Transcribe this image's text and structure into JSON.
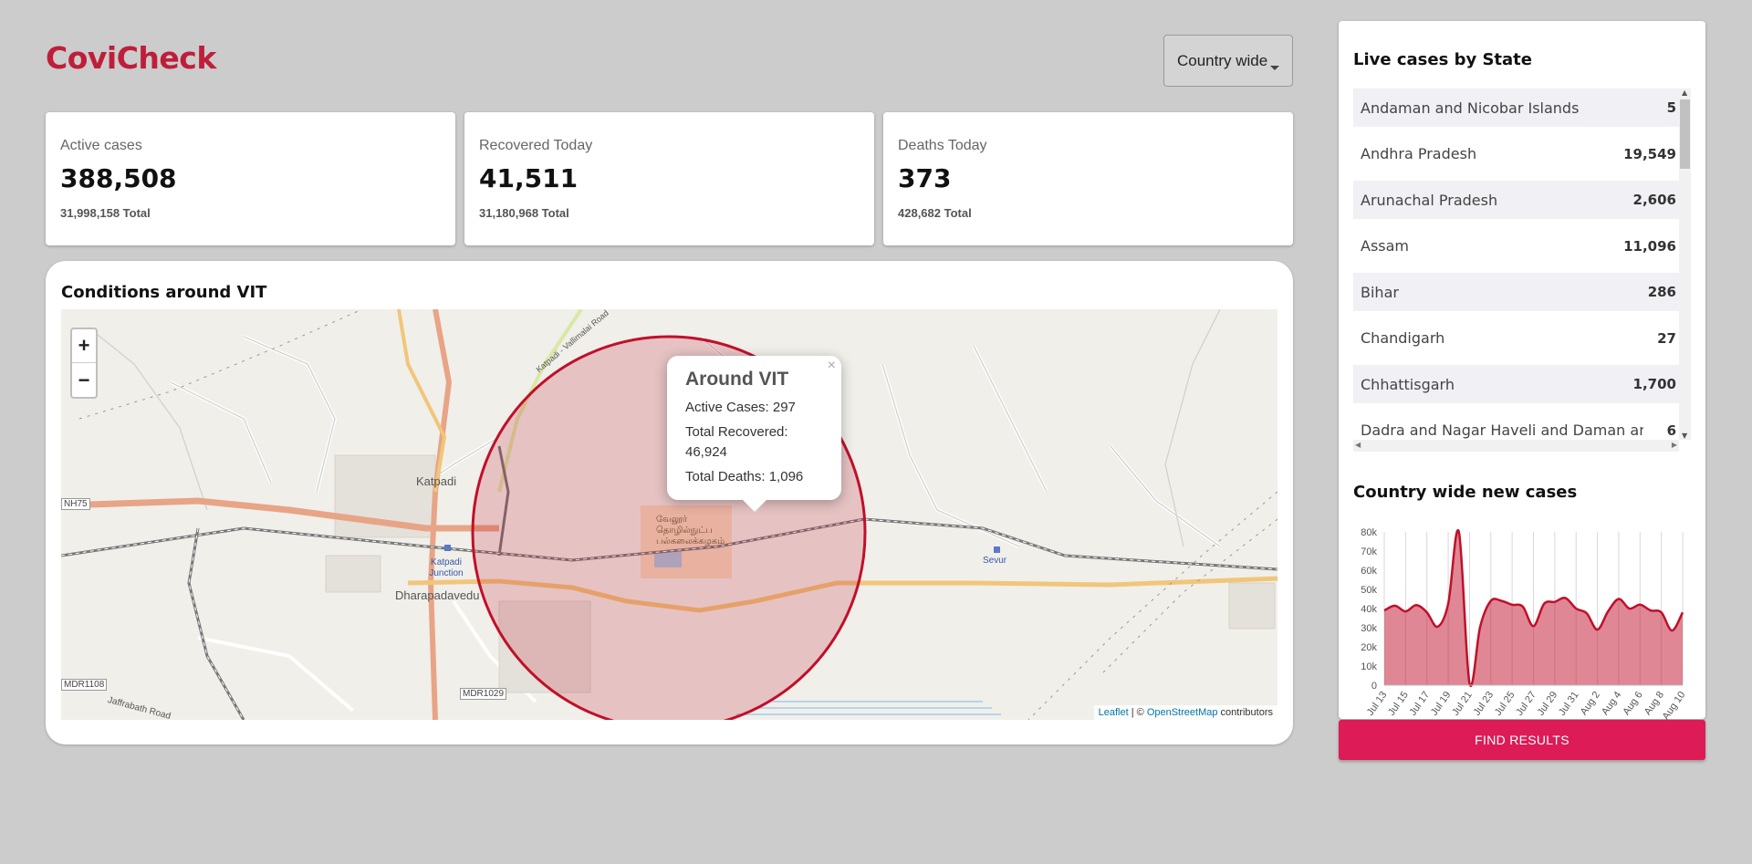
{
  "app": {
    "title": "CoviCheck"
  },
  "region_select": {
    "value": "Country wide"
  },
  "stats": [
    {
      "label": "Active cases",
      "value": "388,508",
      "total": "31,998,158 Total"
    },
    {
      "label": "Recovered Today",
      "value": "41,511",
      "total": "31,180,968 Total"
    },
    {
      "label": "Deaths Today",
      "value": "373",
      "total": "428,682 Total"
    }
  ],
  "map": {
    "title": "Conditions around VIT",
    "zoom_in": "+",
    "zoom_out": "−",
    "popup": {
      "title": "Around VIT",
      "active": "Active Cases: 297",
      "recovered": "Total Recovered: 46,924",
      "deaths": "Total Deaths: 1,096",
      "close": "×"
    },
    "labels": {
      "katpadi": "Katpadi",
      "dharapadavedu": "Dharapadavedu",
      "katpadi_junction": "Katpadi Junction",
      "sevur": "Sevur",
      "nh75": "NH75",
      "mdr1108": "MDR1108",
      "mdr1029": "MDR1029",
      "jaffrabath": "Jaffrabath Road",
      "vallimalai": "Katpadi - Vallimalai Road",
      "campus": "வேலூர் தொழில்நுட்ப பல்கலைக்கழகம்"
    },
    "attribution": {
      "leaflet": "Leaflet",
      "sep": " | © ",
      "osm": "OpenStreetMap",
      "suffix": " contributors"
    },
    "circle_color": "#c0102a"
  },
  "states": {
    "title": "Live cases by State",
    "rows": [
      {
        "name": "Andaman and Nicobar Islands",
        "value": "5"
      },
      {
        "name": "Andhra Pradesh",
        "value": "19,549"
      },
      {
        "name": "Arunachal Pradesh",
        "value": "2,606"
      },
      {
        "name": "Assam",
        "value": "11,096"
      },
      {
        "name": "Bihar",
        "value": "286"
      },
      {
        "name": "Chandigarh",
        "value": "27"
      },
      {
        "name": "Chhattisgarh",
        "value": "1,700"
      },
      {
        "name": "Dadra and Nagar Haveli and Daman and Diu",
        "value": "6"
      }
    ]
  },
  "new_cases": {
    "title": "Country wide new cases"
  },
  "chart_data": {
    "type": "area",
    "title": "Country wide new cases",
    "categories": [
      "Jul 13",
      "Jul 14",
      "Jul 15",
      "Jul 16",
      "Jul 17",
      "Jul 18",
      "Jul 19",
      "Jul 20",
      "Jul 21",
      "Jul 22",
      "Jul 23",
      "Jul 24",
      "Jul 25",
      "Jul 26",
      "Jul 27",
      "Jul 28",
      "Jul 29",
      "Jul 30",
      "Jul 31",
      "Aug 1",
      "Aug 2",
      "Aug 3",
      "Aug 4",
      "Aug 5",
      "Aug 6",
      "Aug 7",
      "Aug 8",
      "Aug 9",
      "Aug 10"
    ],
    "tick_labels": [
      "Jul 13",
      "Jul 15",
      "Jul 17",
      "Jul 19",
      "Jul 21",
      "Jul 23",
      "Jul 25",
      "Jul 27",
      "Jul 29",
      "Jul 31",
      "Aug 2",
      "Aug 4",
      "Aug 6",
      "Aug 8",
      "Aug 10"
    ],
    "values": [
      39000,
      41500,
      38500,
      41800,
      38000,
      30500,
      42500,
      80000,
      1000,
      30500,
      44000,
      44000,
      42000,
      41000,
      30800,
      42500,
      43500,
      45500,
      40000,
      37500,
      29000,
      38500,
      45000,
      40000,
      42000,
      39000,
      38000,
      28500,
      38000
    ],
    "ylim": [
      0,
      80000
    ],
    "yticks": [
      "0",
      "10k",
      "20k",
      "30k",
      "40k",
      "50k",
      "60k",
      "70k",
      "80k"
    ],
    "grid": "vertical",
    "color": "#c0102a"
  }
}
